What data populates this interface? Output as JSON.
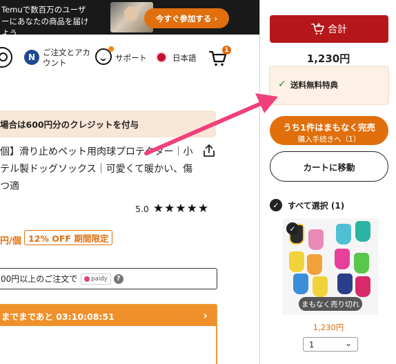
{
  "promo": {
    "text": "Temuで数百万のユーザーにあなたの商品を届けよう",
    "button_label": "今すぐ参加する ›"
  },
  "nav": {
    "account_badge": "N",
    "account_label": "ご注文とアカウント",
    "support_label": "サポート",
    "language_label": "日本語",
    "cart_count": "1"
  },
  "product": {
    "credit_banner": "場合は600円分のクレジットを付与",
    "title": "個】滑り止めペット用肉球プロテクター｜小テル製ドッグソックス｜可愛くて暖かい、傷つ適",
    "rating_value": "5.0",
    "stars": "★★★★★",
    "rating_score": 5,
    "price_unit": "円/個",
    "discount_tag": "12% OFF 期間限定",
    "pay_text": "00円以上のご注文で",
    "paidy_label": "paidy",
    "help_icon": "?",
    "timer_text": "までまであと 03:10:08:51"
  },
  "sidebar": {
    "checkout_label": "合計",
    "total": "1,230円",
    "popover_check": "✓",
    "popover_text": "送料無料特典",
    "soldout_main": "うち1件はまもなく完売",
    "soldout_sub": "購入手続きへ（1）",
    "go_cart_label": "カートに移動",
    "select_all_label": "すべて選択 (1)",
    "item_overlay": "まもなく売り切れ",
    "item_price": "1,230円",
    "quantity": "1"
  },
  "colors": {
    "accent_orange": "#e06f0c",
    "checkout_red": "#b6171a",
    "annotation_arrow": "#f0407a"
  },
  "icons": [
    "search-icon",
    "support-icon",
    "cart-icon",
    "share-icon",
    "check-icon",
    "chevron-down-icon",
    "chevron-right-icon"
  ]
}
